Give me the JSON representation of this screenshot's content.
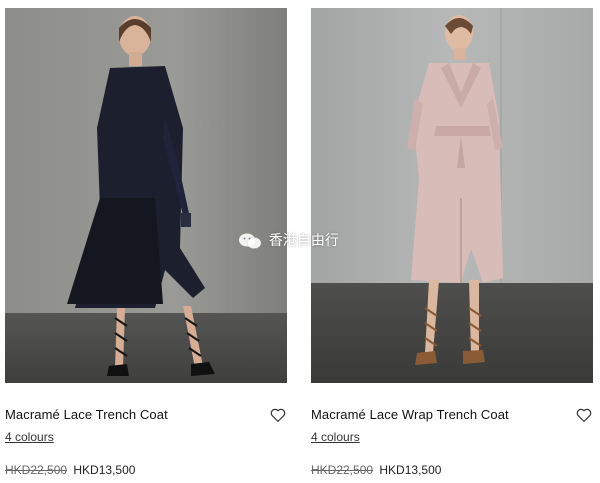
{
  "products": [
    {
      "name": "Macramé Lace Trench Coat",
      "colours_label": "4 colours",
      "old_price": "HKD22,500",
      "new_price": "HKD13,500"
    },
    {
      "name": "Macramé Lace Wrap Trench Coat",
      "colours_label": "4 colours",
      "old_price": "HKD22,500",
      "new_price": "HKD13,500"
    }
  ],
  "watermark": {
    "text": "香港自由行",
    "icon": "wechat-icon"
  },
  "icons": {
    "wishlist": "heart-outline-icon"
  },
  "colors": {
    "studio_wall_left": "#8a8a87",
    "studio_wall_right": "#b3b5b4",
    "floor": "#4a4a48",
    "navy_coat": "#1b1e2c",
    "pink_coat": "#d9bdb9"
  }
}
